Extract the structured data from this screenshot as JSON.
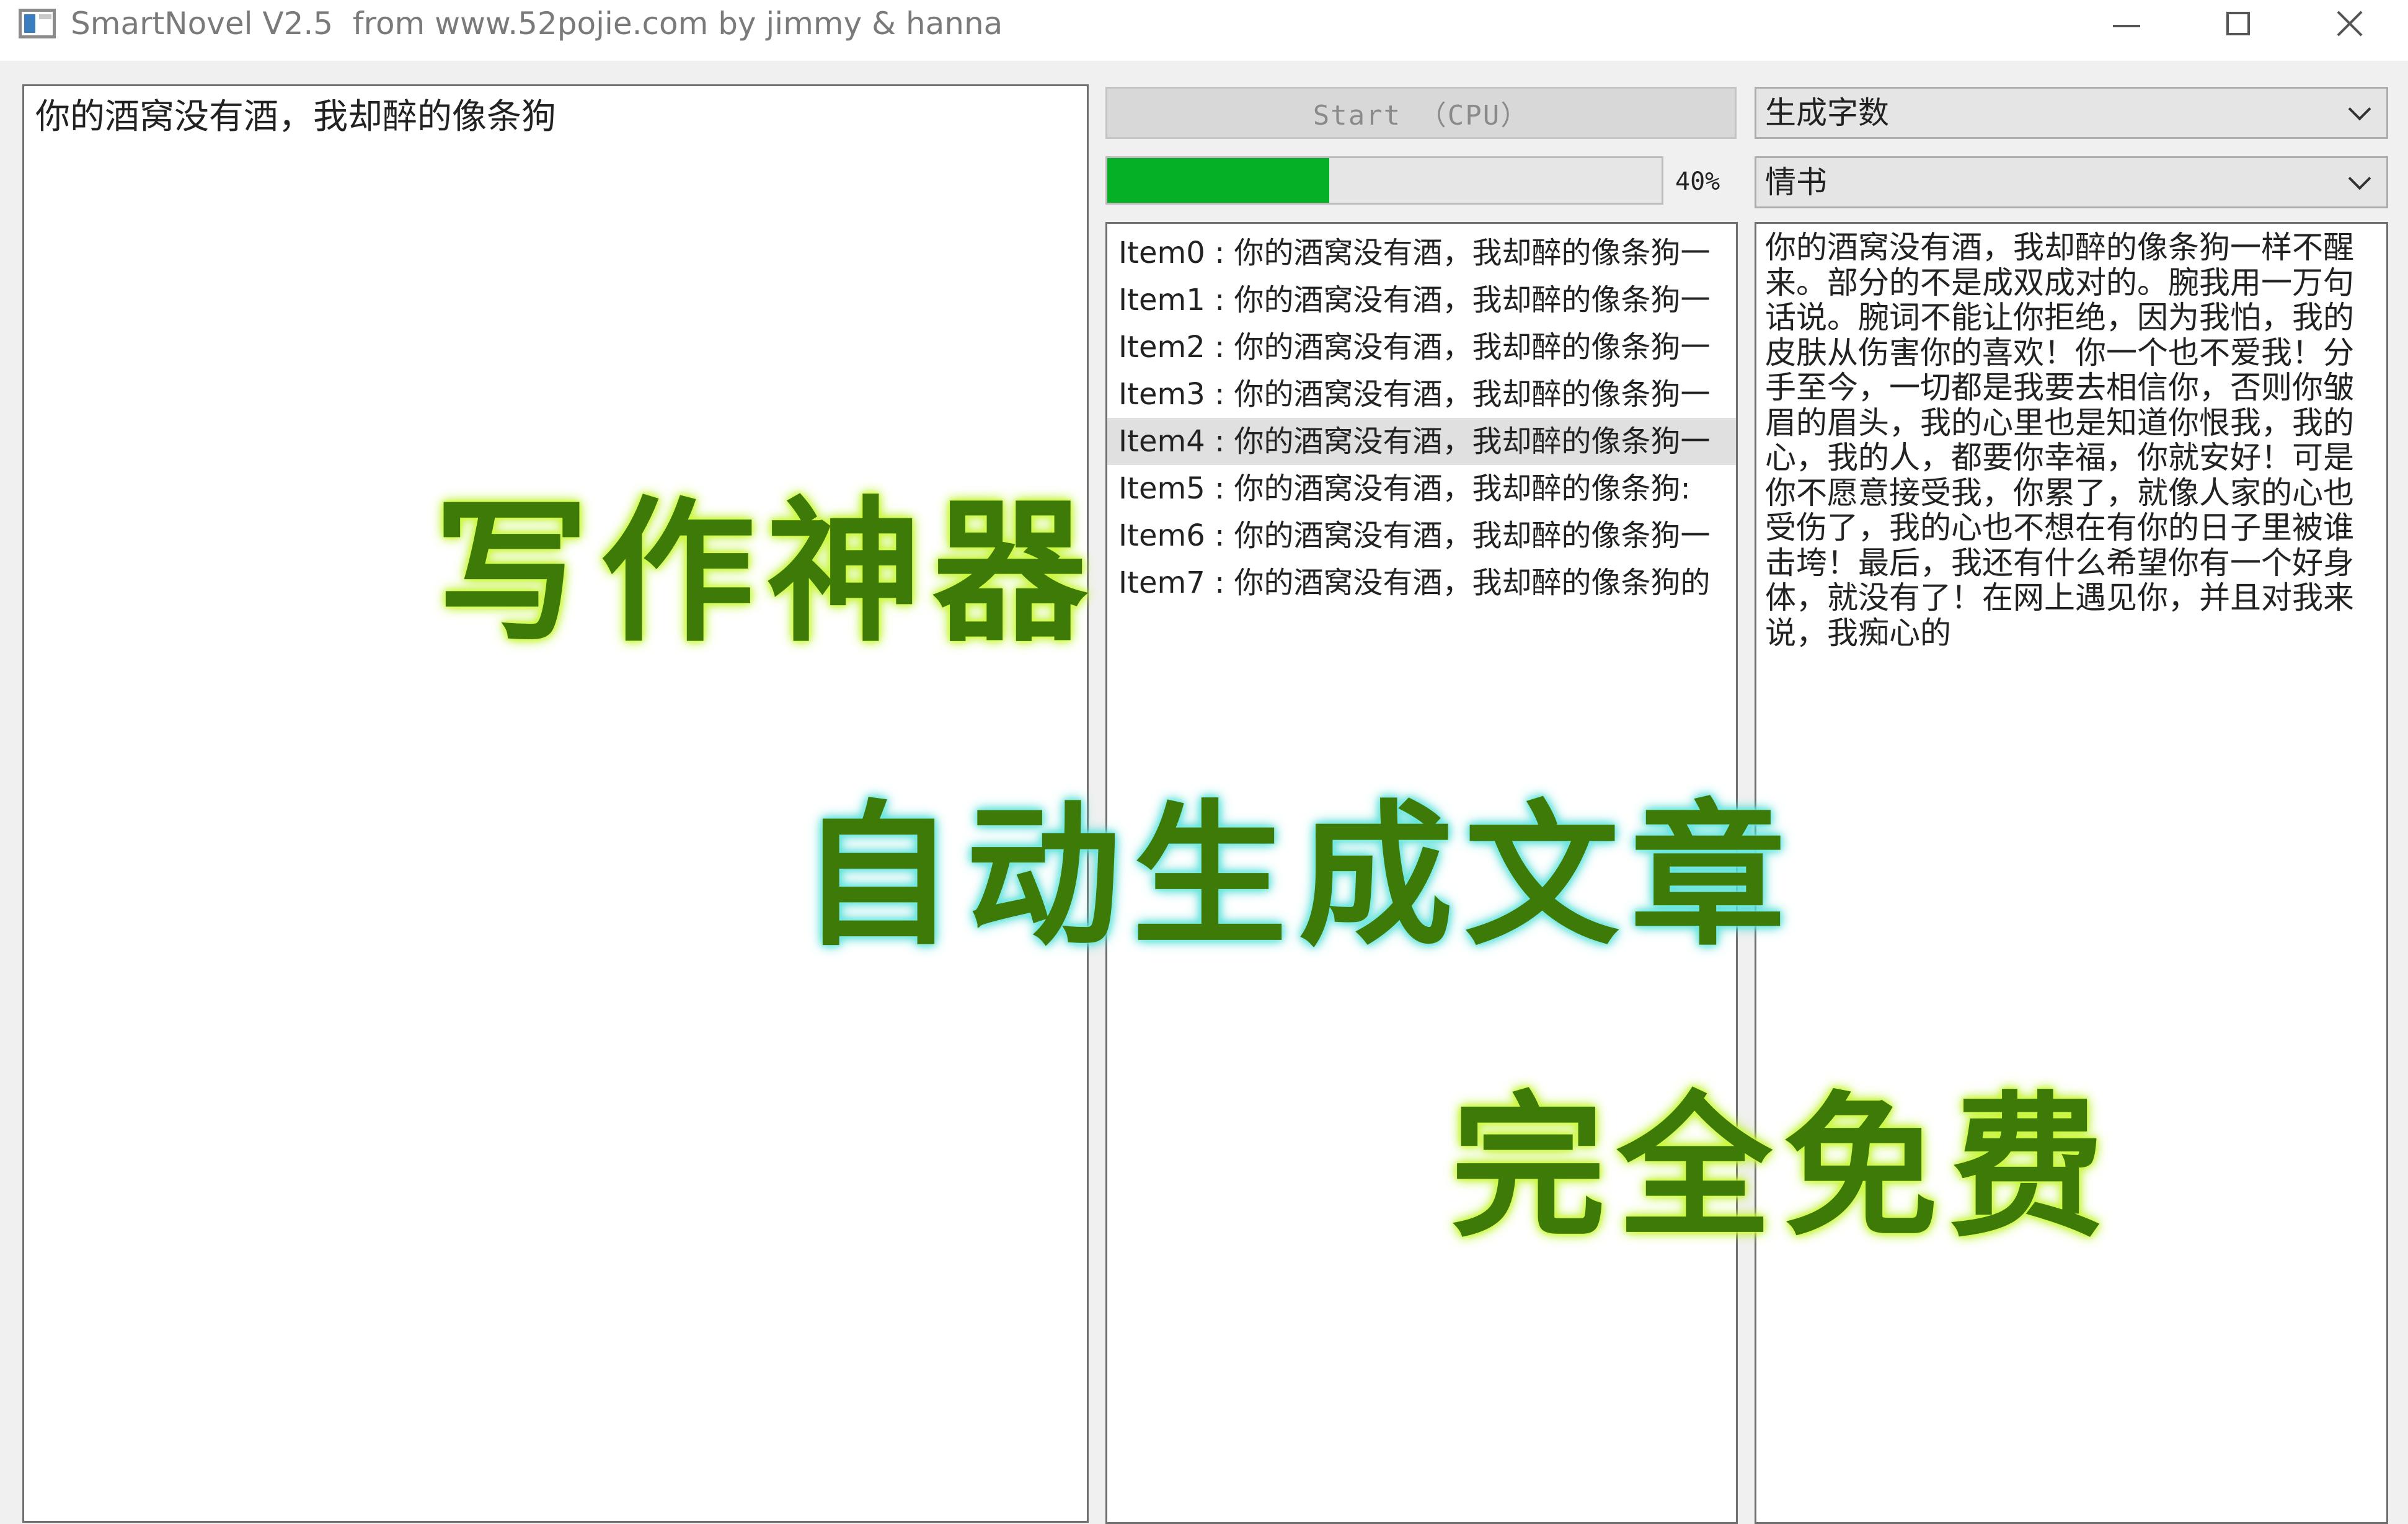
{
  "window": {
    "title": "SmartNovel V2.5  from www.52pojie.com by jimmy & hanna"
  },
  "input": {
    "text": "你的酒窝没有酒，我却醉的像条狗"
  },
  "controls": {
    "start_label": "Start （CPU）",
    "progress_value": 0.4,
    "progress_label": "40%",
    "mode_selected": "生成字数",
    "style_selected": "情书"
  },
  "results": {
    "items": [
      "Item0 : 你的酒窝没有酒，我却醉的像条狗一",
      "Item1 : 你的酒窝没有酒，我却醉的像条狗一",
      "Item2 : 你的酒窝没有酒，我却醉的像条狗一",
      "Item3 : 你的酒窝没有酒，我却醉的像条狗一",
      "Item4 : 你的酒窝没有酒，我却醉的像条狗一",
      "Item5 : 你的酒窝没有酒，我却醉的像条狗:",
      "Item6 : 你的酒窝没有酒，我却醉的像条狗一",
      "Item7 : 你的酒窝没有酒，我却醉的像条狗的"
    ],
    "selected_index": 4
  },
  "output": {
    "text": "你的酒窝没有酒，我却醉的像条狗一样不醒来。部分的不是成双成对的。腕我用一万句话说。腕词不能让你拒绝，因为我怕，我的皮肤从伤害你的喜欢！你一个也不爱我！分手至今，一切都是我要去相信你，否则你皱眉的眉头，我的心里也是知道你恨我，我的心，我的人，都要你幸福，你就安好！可是你不愿意接受我，你累了，就像人家的心也受伤了，我的心也不想在有你的日子里被谁击垮！最后，我还有什么希望你有一个好身体，就没有了！在网上遇见你，并且对我来说，我痴心的"
  },
  "overlays": {
    "line1": "写作神器",
    "line2": "自动生成文章",
    "line3": "完全免费"
  }
}
